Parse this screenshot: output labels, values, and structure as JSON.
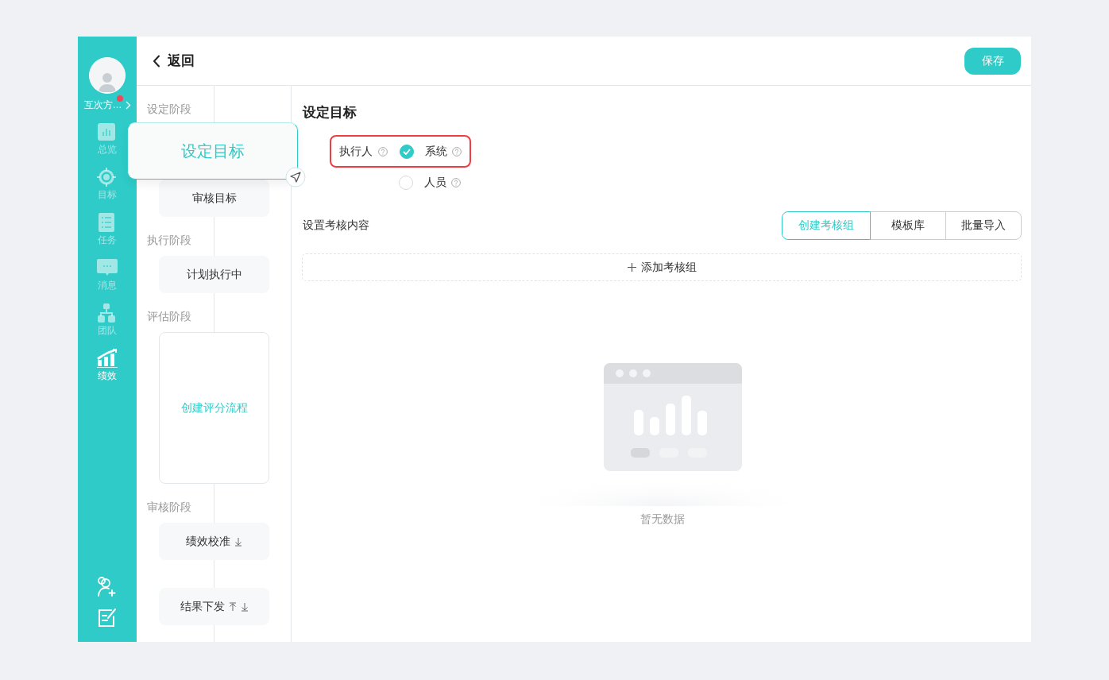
{
  "header": {
    "back_label": "返回",
    "save_label": "保存"
  },
  "sidebar": {
    "user": {
      "name": "互次方…",
      "has_notification": true
    },
    "nav": [
      {
        "label": "总览",
        "kind": "overview",
        "selected": false
      },
      {
        "label": "目标",
        "kind": "target",
        "selected": false
      },
      {
        "label": "任务",
        "kind": "task",
        "selected": false
      },
      {
        "label": "消息",
        "kind": "message",
        "selected": false
      },
      {
        "label": "团队",
        "kind": "team",
        "selected": false
      },
      {
        "label": "绩效",
        "kind": "performance",
        "selected": true
      }
    ]
  },
  "stages": [
    {
      "label": "设定阶段",
      "steps": [
        {
          "label": "设定目标",
          "kind": "focused",
          "move_up": false,
          "move_down": false
        },
        {
          "label": "审核目标",
          "kind": "normal",
          "move_up": false,
          "move_down": false
        }
      ]
    },
    {
      "label": "执行阶段",
      "steps": [
        {
          "label": "计划执行中",
          "kind": "normal",
          "move_up": false,
          "move_down": false
        }
      ]
    },
    {
      "label": "评估阶段",
      "steps": [
        {
          "label": "创建评分流程",
          "kind": "create",
          "move_up": false,
          "move_down": false
        }
      ]
    },
    {
      "label": "审核阶段",
      "steps": [
        {
          "label": "绩效校准",
          "kind": "normal",
          "move_up": false,
          "move_down": true
        },
        {
          "label": "结果下发",
          "kind": "normal",
          "move_up": true,
          "move_down": true
        }
      ]
    }
  ],
  "main": {
    "title": "设定目标",
    "executor": {
      "label": "执行人",
      "options": [
        {
          "label": "系统",
          "selected": true
        },
        {
          "label": "人员",
          "selected": false
        }
      ]
    },
    "content": {
      "label": "设置考核内容",
      "actions": [
        {
          "label": "创建考核组",
          "selected": true
        },
        {
          "label": "模板库",
          "selected": false
        },
        {
          "label": "批量导入",
          "selected": false
        }
      ],
      "add_label": "添加考核组",
      "empty_text": "暂无数据"
    }
  }
}
